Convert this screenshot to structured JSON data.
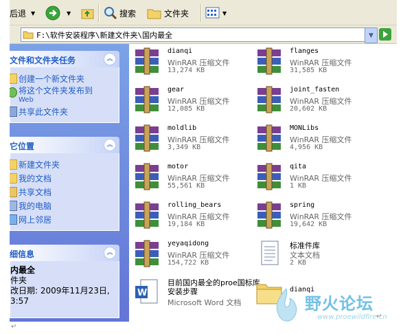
{
  "toolbar": {
    "back_label": "后退",
    "search_label": "搜索",
    "folders_label": "文件夹"
  },
  "address": {
    "path": "F:\\软件安装程序\\新建文件夹\\国内最全"
  },
  "tasks_panel": {
    "title": "文件和文件夹任务",
    "items": [
      "创建一个新文件夹",
      "将这个文件夹发布到",
      "Web",
      "共享此文件夹"
    ]
  },
  "places_panel": {
    "title": "它位置",
    "items": [
      "新建文件夹",
      "我的文档",
      "共享文档",
      "我的电脑",
      "网上邻居"
    ]
  },
  "details_panel": {
    "title": "细信息",
    "name": "内最全",
    "type": "件夹",
    "modified_line1": "改日期: 2009年11月23日,",
    "modified_line2": "3:57"
  },
  "files": [
    {
      "name": "dianqi",
      "type": "WinRAR 压缩文件",
      "size": "13,274 KB",
      "icon": "winrar-archive-icon"
    },
    {
      "name": "flanges",
      "type": "WinRAR 压缩文件",
      "size": "31,585 KB",
      "icon": "winrar-archive-icon"
    },
    {
      "name": "gear",
      "type": "WinRAR 压缩文件",
      "size": "12,085 KB",
      "icon": "winrar-archive-icon"
    },
    {
      "name": "joint_fasten",
      "type": "WinRAR 压缩文件",
      "size": "20,602 KB",
      "icon": "winrar-archive-icon"
    },
    {
      "name": "moldlib",
      "type": "WinRAR 压缩文件",
      "size": "3,349 KB",
      "icon": "winrar-archive-icon"
    },
    {
      "name": "MONLibs",
      "type": "WinRAR 压缩文件",
      "size": "4,956 KB",
      "icon": "winrar-archive-icon"
    },
    {
      "name": "motor",
      "type": "WinRAR 压缩文件",
      "size": "55,561 KB",
      "icon": "winrar-archive-icon"
    },
    {
      "name": "qita",
      "type": "WinRAR 压缩文件",
      "size": "1 KB",
      "icon": "winrar-archive-icon"
    },
    {
      "name": "rolling_bears",
      "type": "WinRAR 压缩文件",
      "size": "19,184 KB",
      "icon": "winrar-archive-icon"
    },
    {
      "name": "spring",
      "type": "WinRAR 压缩文件",
      "size": "19,642 KB",
      "icon": "winrar-archive-icon"
    },
    {
      "name": "yeyaqidong",
      "type": "WinRAR 压缩文件",
      "size": "154,722 KB",
      "icon": "winrar-archive-icon"
    },
    {
      "name": "标准件库",
      "type": "文本文档",
      "size": "2 KB",
      "icon": "text-document-icon"
    },
    {
      "name": "目前国内最全的proe国标库安装步骤",
      "type": "Microsoft Word 文档",
      "size": "",
      "icon": "word-document-icon"
    },
    {
      "name": "dianqi",
      "type": "",
      "size": "",
      "icon": "folder-icon"
    }
  ],
  "watermark": {
    "title": "野火论坛",
    "url": "www.proewildfire.cn"
  },
  "colors": {
    "sidebar_top": "#7ba2e7",
    "sidebar_bottom": "#6375d6",
    "link": "#215dc6"
  }
}
